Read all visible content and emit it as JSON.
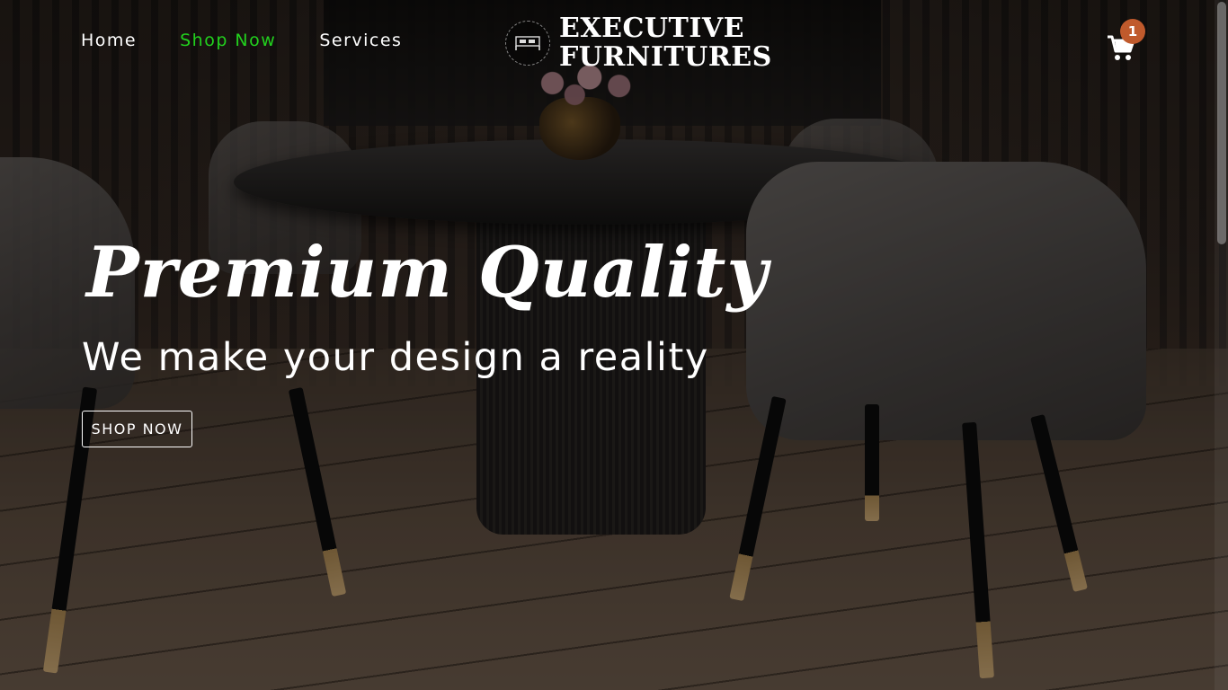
{
  "nav": {
    "items": [
      {
        "label": "Home",
        "active": false
      },
      {
        "label": "Shop Now",
        "active": true
      },
      {
        "label": "Services",
        "active": false
      }
    ],
    "active_color": "#22d11e"
  },
  "logo": {
    "line1": "EXECUTIVE",
    "line2": "FURNITURES",
    "icon": "bed-icon"
  },
  "cart": {
    "icon": "shopping-cart-icon",
    "count": "1",
    "badge_color": "#c05a2c"
  },
  "hero": {
    "title": "Premium Quality",
    "subtitle": "We make your design a reality",
    "button_label": "SHOP NOW"
  }
}
